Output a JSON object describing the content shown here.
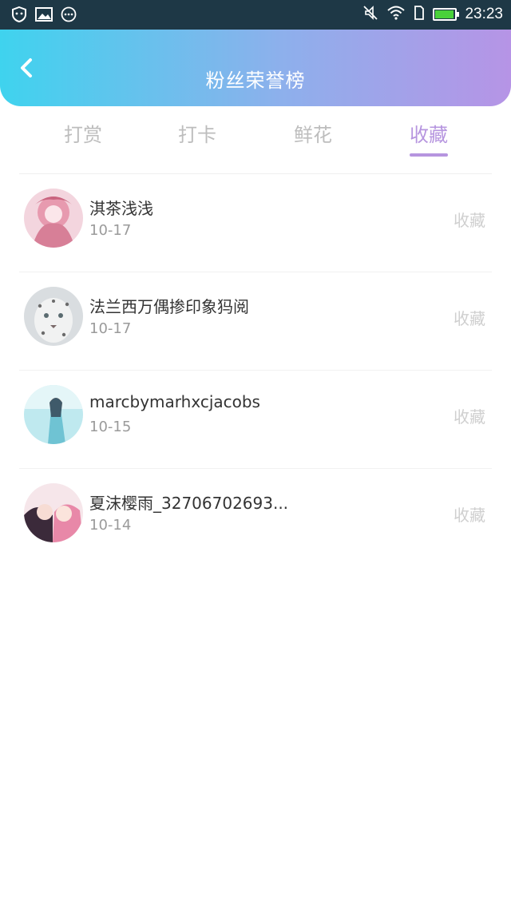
{
  "status_bar": {
    "time": "23:23",
    "left_icons": [
      "shield-icon",
      "image-icon",
      "more-dots-icon"
    ],
    "right_icons": [
      "mute-icon",
      "wifi-icon",
      "sim-icon",
      "battery-icon"
    ],
    "battery_level": 0.95,
    "battery_color": "#49d13a"
  },
  "header": {
    "title": "粉丝荣誉榜",
    "back_icon": "back-chevron-icon",
    "gradient": [
      "#3fd3ee",
      "#b694e6"
    ]
  },
  "tabs": [
    {
      "label": "打赏",
      "active": false
    },
    {
      "label": "打卡",
      "active": false
    },
    {
      "label": "鲜花",
      "active": false
    },
    {
      "label": "收藏",
      "active": true
    }
  ],
  "accent_color": "#b695df",
  "fans": [
    {
      "name": "淇茶浅浅",
      "date": "10-17",
      "kind": "收藏"
    },
    {
      "name": "法兰西万偶掺印象犸阅",
      "date": "10-17",
      "kind": "收藏"
    },
    {
      "name": "marcbymarhxcjacobs",
      "date": "10-15",
      "kind": "收藏"
    },
    {
      "name": "夏沫樱雨_32706702693...",
      "date": "10-14",
      "kind": "收藏"
    }
  ]
}
